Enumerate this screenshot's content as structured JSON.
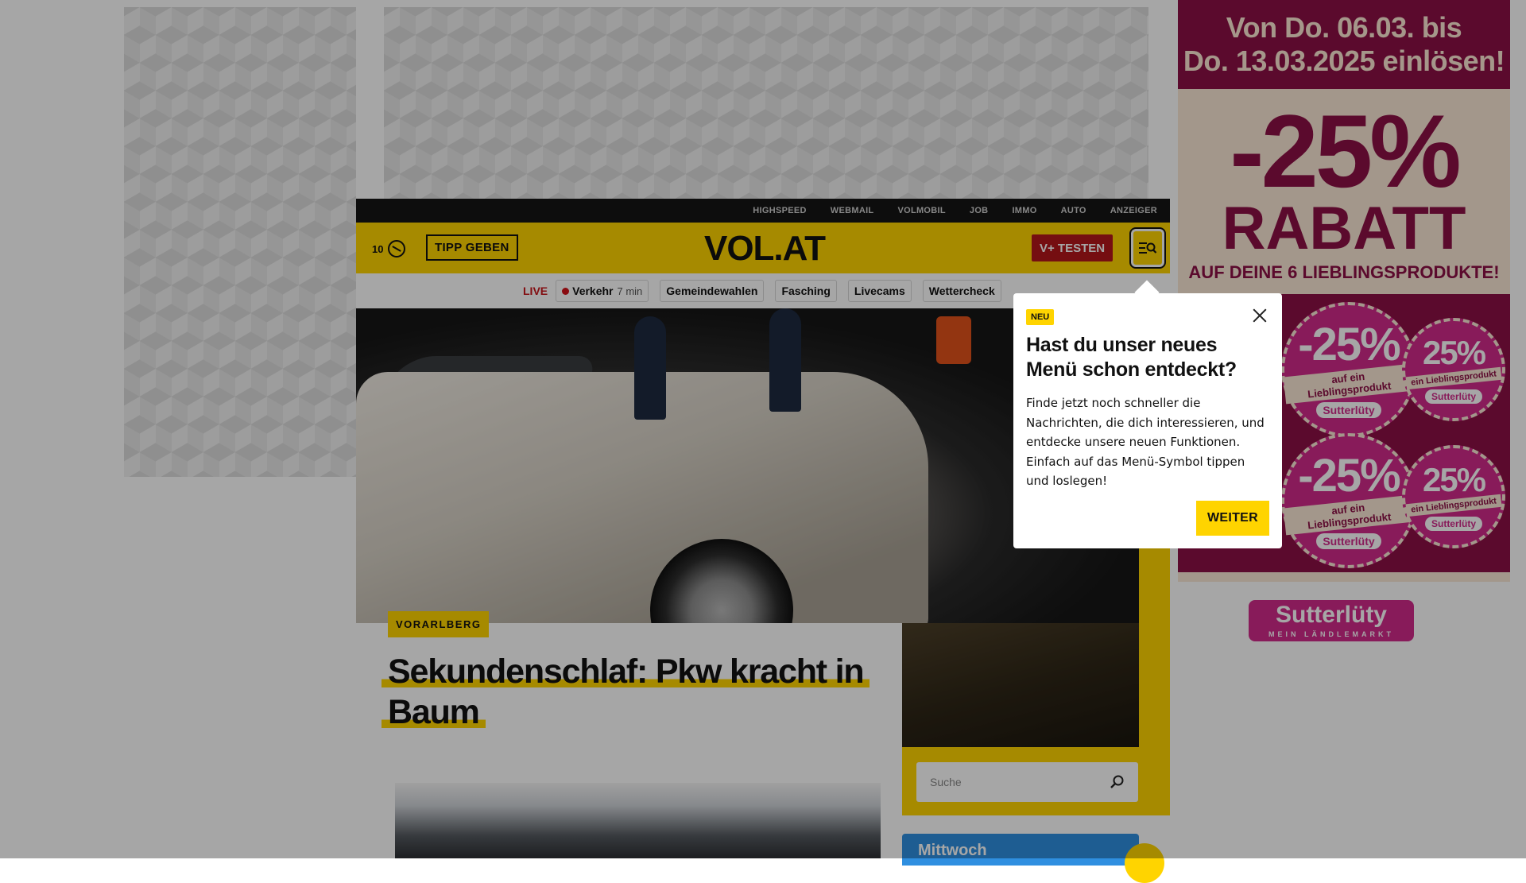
{
  "topbar": {
    "links": [
      "HIGHSPEED",
      "WEBMAIL",
      "VOLMOBIL",
      "JOB",
      "IMMO",
      "AUTO",
      "ANZEIGER"
    ]
  },
  "header": {
    "count": "10",
    "tipp_label": "TIPP GEBEN",
    "logo": "VOL.AT",
    "vtest_label": "V+ TESTEN"
  },
  "subnav": {
    "live": "LIVE",
    "verkehr_label": "Verkehr",
    "verkehr_time": "7 min",
    "chips": [
      "Gemeindewahlen",
      "Fasching",
      "Livecams",
      "Wettercheck"
    ]
  },
  "article": {
    "tag": "VORARLBERG",
    "title_line1": "Sekundenschlaf: Pkw kracht in",
    "title_line2": "Baum"
  },
  "search": {
    "placeholder": "Suche"
  },
  "weather": {
    "day": "Mittwoch"
  },
  "ad": {
    "line1": "Von Do. 06.03. bis",
    "line2": "Do. 13.03.2025 einlösen!",
    "discount": "-25%",
    "rabatt": "RABATT",
    "sub": "AUF DEINE 6 LIEBLINGSPRODUKTE!",
    "sticker_pct": "-25%",
    "sticker_pct_small": "25%",
    "sticker_label": "auf ein Lieblingsprodukt",
    "sticker_label_small": "ein Lieblingsprodukt",
    "sticker_brand": "Sutterlüty",
    "brand": "Sutterlüty",
    "brand_sub": "MEIN LÄNDLEMARKT"
  },
  "popup": {
    "badge": "NEU",
    "title": "Hast du unser neues Menü schon entdeckt?",
    "body": "Finde jetzt noch schneller die Nachrichten, die dich interessieren, und entdecke unsere neuen Funktionen. Einfach auf das Menü-Symbol tippen und loslegen!",
    "button": "WEITER"
  },
  "colors": {
    "brand_yellow": "#ffd400",
    "live_red": "#c8141b",
    "vtest_red": "#b4161b",
    "ad_maroon": "#8c1046",
    "ad_pink": "#d22a8a"
  }
}
